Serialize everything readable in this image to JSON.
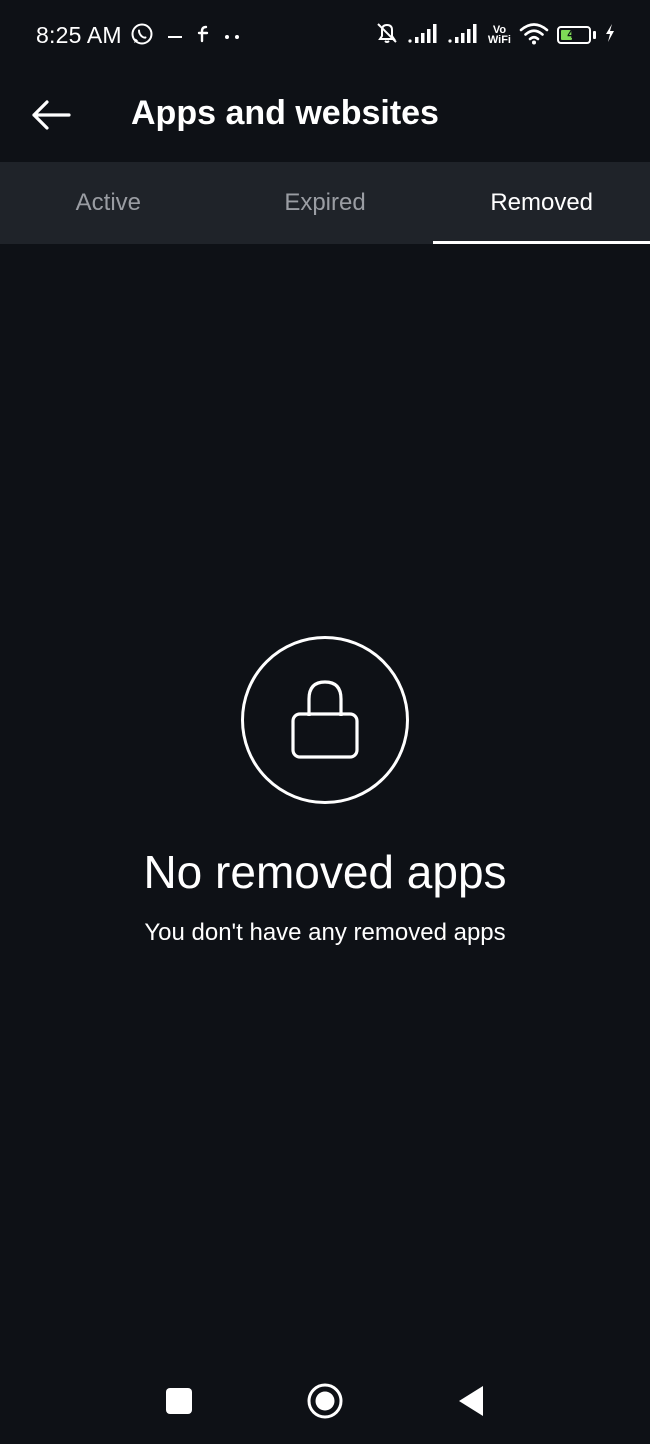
{
  "status_bar": {
    "time": "8:25 AM",
    "left_icons": [
      "whatsapp-icon",
      "notification-dots-icon",
      "facebook-icon",
      "more-dots-icon"
    ],
    "right_icons": [
      "muted-bell-icon",
      "signal-icon",
      "signal-icon",
      "vowifi-icon",
      "wifi-icon",
      "battery-icon",
      "charging-icon"
    ],
    "vowifi_top": "Vo",
    "vowifi_bottom": "WiFi",
    "battery_level": 49,
    "battery_color": "#7ed957"
  },
  "header": {
    "back_icon": "arrow-left-icon",
    "title": "Apps and websites"
  },
  "tabs": [
    {
      "label": "Active",
      "selected": false
    },
    {
      "label": "Expired",
      "selected": false
    },
    {
      "label": "Removed",
      "selected": true
    }
  ],
  "empty_state": {
    "icon": "lock-icon",
    "title": "No removed apps",
    "subtitle": "You don't have any removed apps"
  },
  "nav_bar": {
    "buttons": [
      "recent-apps-icon",
      "home-icon",
      "back-triangle-icon"
    ]
  },
  "colors": {
    "background": "#0e1116",
    "tab_bar": "#1f2329",
    "tab_inactive_text": "#9a9da3",
    "text": "#ffffff"
  }
}
